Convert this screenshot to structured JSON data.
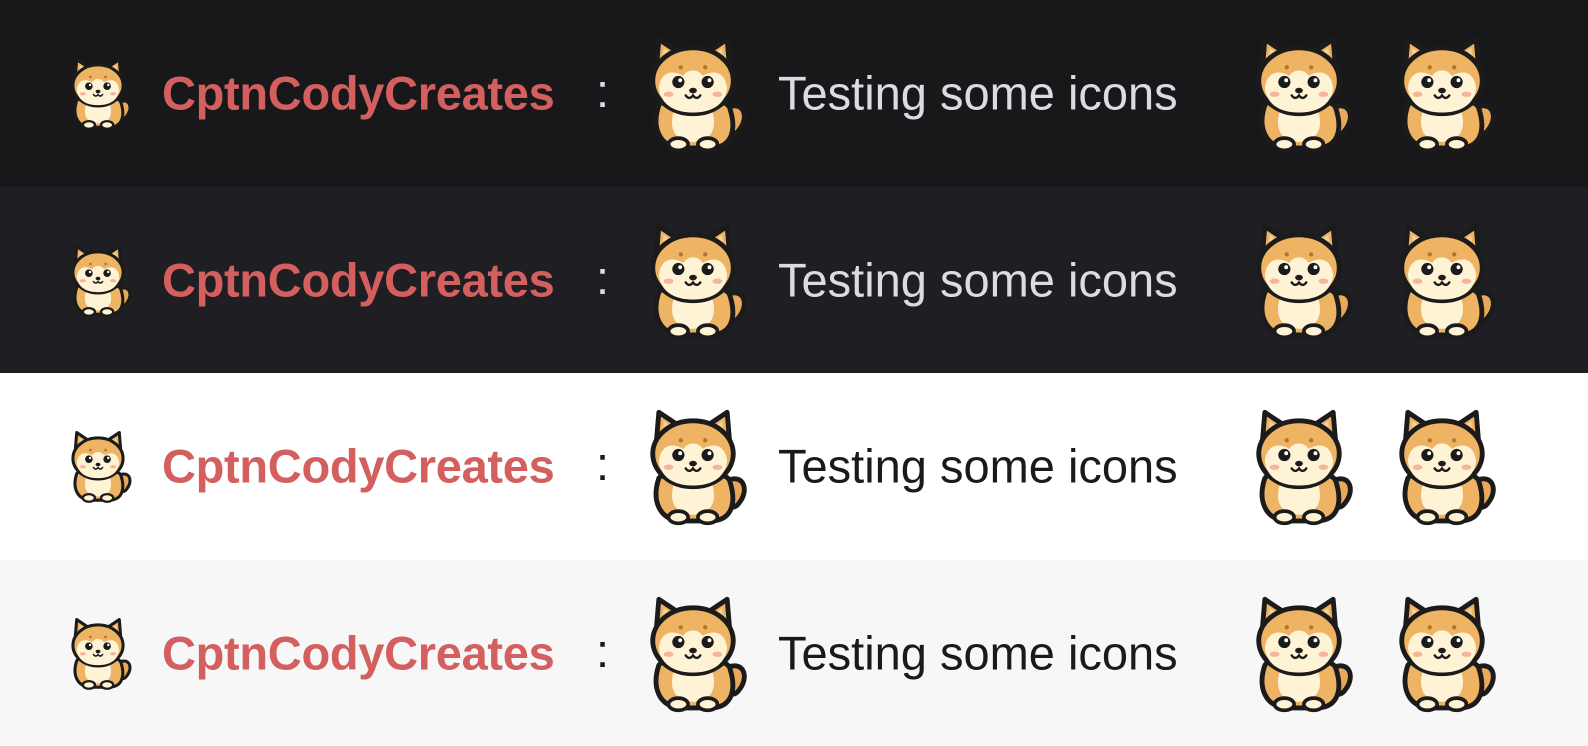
{
  "rows": [
    {
      "username": "CptnCodyCreates",
      "separator": ":",
      "message": "Testing some icons"
    },
    {
      "username": "CptnCodyCreates",
      "separator": ":",
      "message": "Testing some icons"
    },
    {
      "username": "CptnCodyCreates",
      "separator": ":",
      "message": "Testing some icons"
    },
    {
      "username": "CptnCodyCreates",
      "separator": ":",
      "message": "Testing some icons"
    }
  ],
  "icons": {
    "badge": "shiba-dog-icon",
    "emote": "shiba-dog-emote-icon"
  },
  "colors": {
    "username": "#d35f5f",
    "row_backgrounds": [
      "#18181b",
      "#1f1f23",
      "#ffffff",
      "#f7f7f8"
    ],
    "text_dark_theme": "#dcdce0",
    "text_light_theme": "#1a1a1d"
  }
}
